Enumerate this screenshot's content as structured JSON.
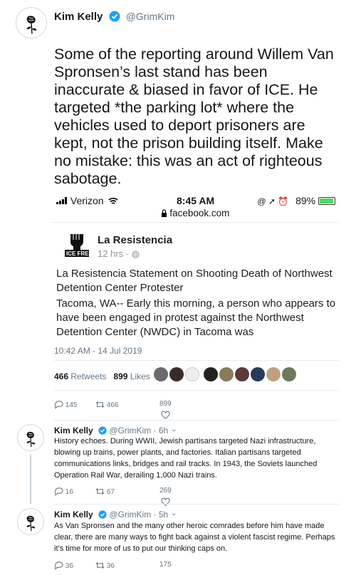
{
  "main_tweet": {
    "name": "Kim Kelly",
    "handle": "@GrimKim",
    "text": "Some of the reporting around Willem Van Spronsen’s last stand has been inaccurate & biased in favor of ICE. He targeted *the parking lot* where the vehicles used to deport prisoners are kept, not the prison building itself. Make no mistake: this was an act of righteous sabotage.",
    "timestamp": "10:42 AM - 14 Jul 2019",
    "retweets_count": "466",
    "retweets_label": "Retweets",
    "likes_count": "899",
    "likes_label": "Likes",
    "actions": {
      "replies": "145",
      "retweets": "466",
      "likes": "899"
    }
  },
  "screenshot": {
    "carrier": "Verizon",
    "time": "8:45 AM",
    "battery": "89%",
    "url": "facebook.com",
    "page_name": "La Resistencia",
    "page_time": "12 hrs ·",
    "logo_text": "ICE FREE",
    "post_title": "La Resistencia Statement on Shooting Death of Northwest Detention Center Protester",
    "post_body": "Tacoma, WA-- Early this morning, a person who appears to have been engaged in protest against the Northwest Detention Center (NWDC) in Tacoma was"
  },
  "replies": [
    {
      "name": "Kim Kelly",
      "meta": "@GrimKim · 6h",
      "text": "History echoes. During WWII, Jewish partisans targeted Nazi infrastructure, blowing up trains, power plants, and factories. Italian partisans targeted communications links, bridges and rail tracks. In 1943, the Soviets launched Operation Rail War, derailing 1,000 Nazi trains.",
      "actions": {
        "replies": "16",
        "retweets": "67",
        "likes": "269"
      }
    },
    {
      "name": "Kim Kelly",
      "meta": "@GrimKim · 5h",
      "text": "As Van Spronsen and the many other heroic comrades before him have made clear, there are many ways to fight back against a violent fascist regime. Perhaps it’s time for more of us to put our thinking caps on.",
      "actions": {
        "replies": "36",
        "retweets": "36",
        "likes": "175"
      }
    }
  ],
  "colors": {
    "verified": "#1da1f2",
    "secondary_text": "#657786",
    "divider": "#e6ecf0"
  },
  "icons": [
    "rose-avatar-icon",
    "verified-badge-icon",
    "reply-icon",
    "retweet-icon",
    "like-icon",
    "chevron-down-icon",
    "lock-icon",
    "wifi-icon",
    "signal-icon"
  ]
}
